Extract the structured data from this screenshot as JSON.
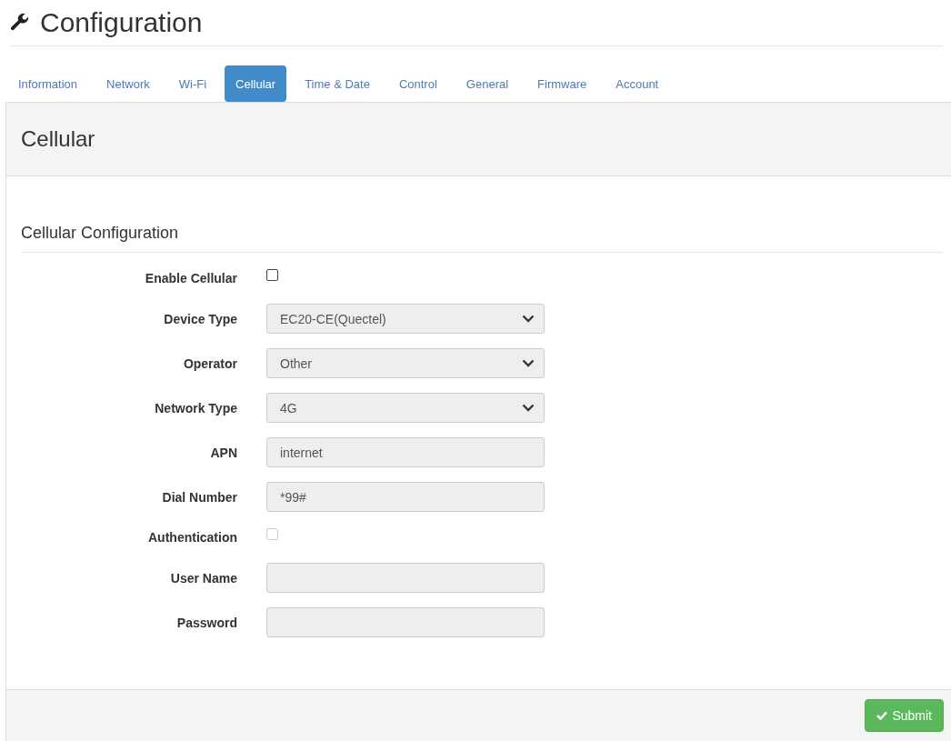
{
  "page": {
    "title": "Configuration"
  },
  "tabs": [
    {
      "label": "Information",
      "selected": false
    },
    {
      "label": "Network",
      "selected": false
    },
    {
      "label": "Wi-Fi",
      "selected": false
    },
    {
      "label": "Cellular",
      "selected": true
    },
    {
      "label": "Time & Date",
      "selected": false
    },
    {
      "label": "Control",
      "selected": false
    },
    {
      "label": "General",
      "selected": false
    },
    {
      "label": "Firmware",
      "selected": false
    },
    {
      "label": "Account",
      "selected": false
    }
  ],
  "panel": {
    "title": "Cellular",
    "section": "Cellular Configuration"
  },
  "fields": [
    {
      "kind": "checkbox",
      "label": "Enable Cellular",
      "checked": false,
      "disabled": false
    },
    {
      "kind": "select",
      "label": "Device Type",
      "value": "EC20-CE(Quectel)",
      "disabled": true
    },
    {
      "kind": "select",
      "label": "Operator",
      "value": "Other",
      "disabled": true
    },
    {
      "kind": "select",
      "label": "Network Type",
      "value": "4G",
      "disabled": true
    },
    {
      "kind": "text",
      "label": "APN",
      "value": "internet",
      "disabled": true
    },
    {
      "kind": "text",
      "label": "Dial Number",
      "value": "*99#",
      "disabled": true
    },
    {
      "kind": "checkbox",
      "label": "Authentication",
      "checked": false,
      "disabled": true
    },
    {
      "kind": "text",
      "label": "User Name",
      "disabled": true
    },
    {
      "kind": "text",
      "label": "Password",
      "disabled": true
    }
  ],
  "submit": {
    "label": "Submit"
  }
}
